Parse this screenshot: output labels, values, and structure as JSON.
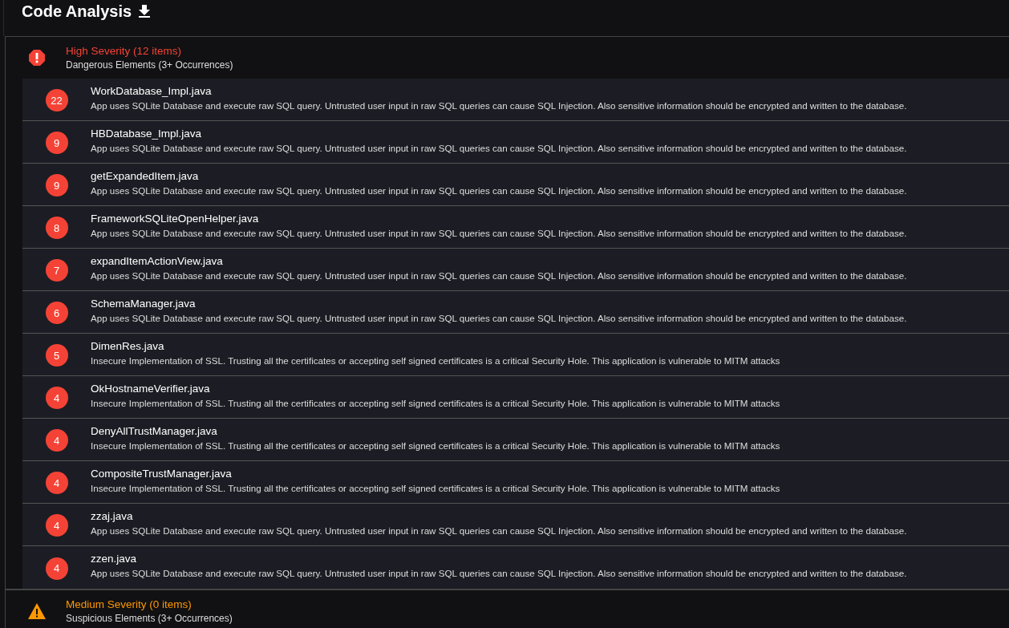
{
  "page": {
    "title": "Code Analysis"
  },
  "sections": [
    {
      "kind": "high",
      "title": "High Severity (12 items)",
      "subtitle": "Dangerous Elements (3+ Occurrences)",
      "items": [
        {
          "count": "22",
          "file": "WorkDatabase_Impl.java",
          "description": "App uses SQLite Database and execute raw SQL query. Untrusted user input in raw SQL queries can cause SQL Injection. Also sensitive information should be encrypted and written to the database."
        },
        {
          "count": "9",
          "file": "HBDatabase_Impl.java",
          "description": "App uses SQLite Database and execute raw SQL query. Untrusted user input in raw SQL queries can cause SQL Injection. Also sensitive information should be encrypted and written to the database."
        },
        {
          "count": "9",
          "file": "getExpandedItem.java",
          "description": "App uses SQLite Database and execute raw SQL query. Untrusted user input in raw SQL queries can cause SQL Injection. Also sensitive information should be encrypted and written to the database."
        },
        {
          "count": "8",
          "file": "FrameworkSQLiteOpenHelper.java",
          "description": "App uses SQLite Database and execute raw SQL query. Untrusted user input in raw SQL queries can cause SQL Injection. Also sensitive information should be encrypted and written to the database."
        },
        {
          "count": "7",
          "file": "expandItemActionView.java",
          "description": "App uses SQLite Database and execute raw SQL query. Untrusted user input in raw SQL queries can cause SQL Injection. Also sensitive information should be encrypted and written to the database."
        },
        {
          "count": "6",
          "file": "SchemaManager.java",
          "description": "App uses SQLite Database and execute raw SQL query. Untrusted user input in raw SQL queries can cause SQL Injection. Also sensitive information should be encrypted and written to the database."
        },
        {
          "count": "5",
          "file": "DimenRes.java",
          "description": "Insecure Implementation of SSL. Trusting all the certificates or accepting self signed certificates is a critical Security Hole. This application is vulnerable to MITM attacks"
        },
        {
          "count": "4",
          "file": "OkHostnameVerifier.java",
          "description": "Insecure Implementation of SSL. Trusting all the certificates or accepting self signed certificates is a critical Security Hole. This application is vulnerable to MITM attacks"
        },
        {
          "count": "4",
          "file": "DenyAllTrustManager.java",
          "description": "Insecure Implementation of SSL. Trusting all the certificates or accepting self signed certificates is a critical Security Hole. This application is vulnerable to MITM attacks"
        },
        {
          "count": "4",
          "file": "CompositeTrustManager.java",
          "description": "Insecure Implementation of SSL. Trusting all the certificates or accepting self signed certificates is a critical Security Hole. This application is vulnerable to MITM attacks"
        },
        {
          "count": "4",
          "file": "zzaj.java",
          "description": "App uses SQLite Database and execute raw SQL query. Untrusted user input in raw SQL queries can cause SQL Injection. Also sensitive information should be encrypted and written to the database."
        },
        {
          "count": "4",
          "file": "zzen.java",
          "description": "App uses SQLite Database and execute raw SQL query. Untrusted user input in raw SQL queries can cause SQL Injection. Also sensitive information should be encrypted and written to the database."
        }
      ]
    },
    {
      "kind": "medium",
      "title": "Medium Severity (0 items)",
      "subtitle": "Suspicious Elements (3+ Occurrences)"
    }
  ]
}
